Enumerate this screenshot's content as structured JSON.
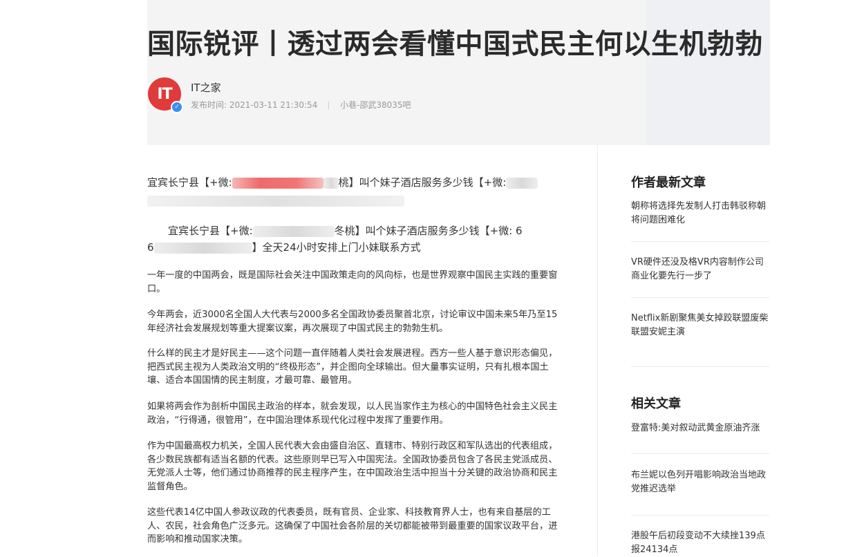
{
  "article": {
    "title": "国际锐评丨透过两会看懂中国式民主何以生机勃勃",
    "author": "IT之家",
    "avatar_text": "IT",
    "publish_label": "发布时间:",
    "publish_time": "2021-03-11 21:30:54",
    "source": "小巷-邵武38035吧"
  },
  "lead": {
    "line1_a": "宜宾长宁县【+微:",
    "line1_b": "桃】叫个妹子酒店服务多少钱【+微:",
    "line3_a": "宜宾长宁县【+微:",
    "line3_b": "冬桃】叫个妹子酒店服务多少钱【+微: 6",
    "line4_a": "6",
    "line4_b": "】全天24小时安排上门小妹联系方式"
  },
  "paragraphs": [
    "一年一度的中国两会，既是国际社会关注中国政策走向的风向标，也是世界观察中国民主实践的重要窗口。",
    "今年两会，近3000名全国人大代表与2000多名全国政协委员聚首北京，讨论审议中国未来5年乃至15年经济社会发展规划等重大提案议案，再次展现了中国式民主的勃勃生机。",
    "什么样的民主才是好民主——这个问题一直伴随着人类社会发展进程。西方一些人基于意识形态偏见，把西式民主视为人类政治文明的“终极形态”，并企图向全球输出。但大量事实证明，只有扎根本国土壤、适合本国国情的民主制度，才最可靠、最管用。",
    "如果将两会作为剖析中国民主政治的样本，就会发现，以人民当家作主为核心的中国特色社会主义民主政治，“行得通，很管用”，在中国治理体系现代化过程中发挥了重要作用。",
    "作为中国最高权力机关，全国人民代表大会由盛自治区、直辖市、特别行政区和军队选出的代表组成，各少数民族都有适当名额的代表。这些原则早已写入中国宪法。全国政协委员包含了各民主党派成员、无党派人士等，他们通过协商推荐的民主程序产生，在中国政治生活中担当十分关键的政治协商和民主监督角色。",
    "这些代表14亿中国人参政议政的代表委员，既有官员、企业家、科技教育界人士，也有来自基层的工人、农民，社会角色广泛多元。这确保了中国社会各阶层的关切都能被带到最重要的国家议政平台，进而影响和推动国家决策。"
  ],
  "sidebar": {
    "latest_heading": "作者最新文章",
    "latest": [
      "朝称将选择先发制人打击韩驳称朝将问题困难化",
      "VR硬件还没及格VR内容制作公司商业化要先行一步了",
      "Netflix新剧聚焦美女掉跤联盟废柴联盟安妮主演"
    ],
    "related_heading": "相关文章",
    "related": [
      "登富特:美对叙动武黄金原油齐涨",
      "布兰妮以色列开唱影响政治当地政党推迟选举",
      "港股午后初段变动不大续挫139点报24134点"
    ]
  },
  "colors": {
    "avatar": "#e03a3a",
    "verified": "#3b8df2",
    "header_band": "#f4f4f4"
  }
}
